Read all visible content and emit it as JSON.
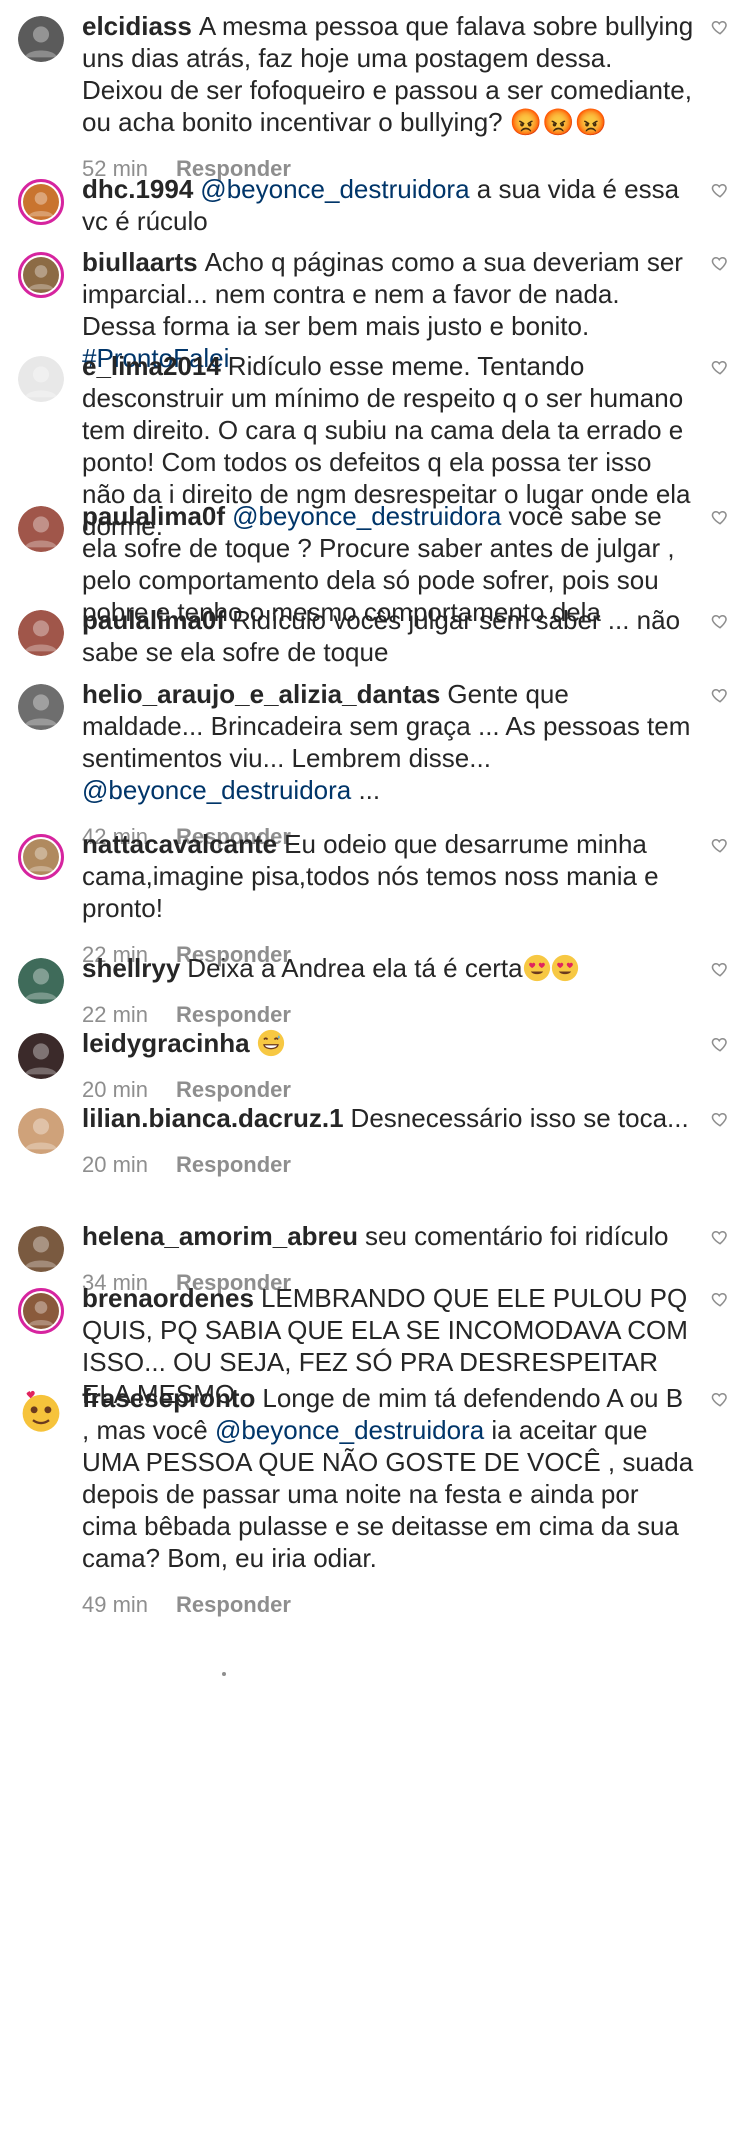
{
  "ui": {
    "reply_label": "Responder"
  },
  "comments": [
    {
      "user": "elcidiass",
      "avatar": {
        "icon": "user-avatar",
        "color": "#5b5b5b",
        "ring": false
      },
      "parts": [
        {
          "t": "A mesma pessoa que falava sobre bullying uns dias atrás, faz hoje uma postagem dessa. Deixou de ser fofoqueiro e passou a ser comediante, ou acha bonito incentivar o bullying? 😡😡😡"
        }
      ],
      "time": "52 min"
    },
    {
      "user": "dhc.1994",
      "avatar": {
        "icon": "user-avatar",
        "color": "#c9742f",
        "ring": true
      },
      "parts": [
        {
          "t": "@beyonce_destruidora",
          "type": "mention"
        },
        {
          "t": " a sua vida é essa vc é rúculo"
        }
      ]
    },
    {
      "user": "biullaarts",
      "avatar": {
        "icon": "user-avatar",
        "color": "#8c6b45",
        "ring": true
      },
      "parts": [
        {
          "t": "Acho q páginas como a sua deveriam ser imparcial... nem contra e nem a favor de nada. Dessa forma ia ser bem mais justo e bonito. "
        },
        {
          "t": "#ProntoFalei",
          "type": "hashtag"
        }
      ]
    },
    {
      "user": "e_lima2014",
      "avatar": {
        "icon": "user-avatar",
        "color": "#e8e8e8",
        "ring": false
      },
      "parts": [
        {
          "t": "Ridículo esse meme. Tentando desconstruir um mínimo de respeito q o ser humano tem direito. O cara q subiu na cama dela ta errado e ponto! Com todos os defeitos q ela possa ter isso não da i direito de ngm desrespeitar o lugar onde ela dorme."
        }
      ]
    },
    {
      "user": "paulalima0f",
      "avatar": {
        "icon": "user-avatar",
        "color": "#a0564a",
        "ring": false
      },
      "parts": [
        {
          "t": "@beyonce_destruidora",
          "type": "mention"
        },
        {
          "t": "  você sabe se ela sofre de toque ? Procure saber antes de julgar , pelo comportamento dela só pode  sofrer, pois sou pobre e tenho o mesmo comportamento dela"
        }
      ]
    },
    {
      "user": "paulalima0f",
      "avatar": {
        "icon": "user-avatar",
        "color": "#a0564a",
        "ring": false
      },
      "parts": [
        {
          "t": "Ridículo vocês julgar sem saber ... não sabe se ela sofre de toque"
        }
      ]
    },
    {
      "user": "helio_araujo_e_alizia_dantas",
      "avatar": {
        "icon": "user-avatar",
        "color": "#6e6e6e",
        "ring": false
      },
      "parts": [
        {
          "t": "Gente que maldade... Brincadeira sem graça ... As pessoas tem sentimentos viu... Lembrem disse... "
        },
        {
          "t": "@beyonce_destruidora",
          "type": "mention"
        },
        {
          "t": " ..."
        }
      ],
      "time": "42 min"
    },
    {
      "user": "nattacavalcante",
      "avatar": {
        "icon": "user-avatar",
        "color": "#b08a5f",
        "ring": true
      },
      "parts": [
        {
          "t": "Eu odeio que desarrume minha cama,imagine pisa,todos nós temos noss mania e pronto!"
        }
      ],
      "time": "22 min"
    },
    {
      "user": "shellryy",
      "avatar": {
        "icon": "user-avatar",
        "color": "#3f6b5a",
        "ring": false
      },
      "parts": [
        {
          "t": "Deixa a Andrea  ela tá é certa"
        },
        {
          "emoji": "heart-eyes"
        },
        {
          "emoji": "heart-eyes"
        }
      ],
      "time": "22 min"
    },
    {
      "user": "leidygracinha",
      "avatar": {
        "icon": "user-avatar",
        "color": "#3b2a2a",
        "ring": false
      },
      "parts": [
        {
          "emoji": "grin-sweat"
        }
      ],
      "time": "20 min"
    },
    {
      "user": "lilian.bianca.dacruz.1",
      "avatar": {
        "icon": "user-avatar",
        "color": "#cfa27a",
        "ring": false
      },
      "parts": [
        {
          "t": "Desnecessário isso se toca..."
        }
      ],
      "time": "20 min"
    },
    {
      "user": "helena_amorim_abreu",
      "avatar": {
        "icon": "user-avatar",
        "color": "#7a5a40",
        "ring": false
      },
      "parts": [
        {
          "t": "seu comentário foi ridículo"
        }
      ],
      "time": "34 min"
    },
    {
      "user": "brenaordenes",
      "avatar": {
        "icon": "user-avatar",
        "color": "#8a5a3c",
        "ring": true
      },
      "parts": [
        {
          "t": "LEMBRANDO QUE ELE PULOU PQ QUIS, PQ SABIA QUE ELA SE INCOMODAVA COM ISSO... OU SEJA, FEZ SÓ PRA DESRESPEITAR ELA MESMO"
        }
      ]
    },
    {
      "user": "frasesepronto",
      "avatar": {
        "icon": "emoji-avatar",
        "color": "#f6c33b",
        "ring": false
      },
      "parts": [
        {
          "t": "Longe de mim tá defendendo A ou B , mas você "
        },
        {
          "t": "@beyonce_destruidora",
          "type": "mention"
        },
        {
          "t": " ia aceitar  que UMA PESSOA QUE NÃO GOSTE DE VOCÊ , suada depois de passar uma noite na festa e ainda por cima bêbada pulasse e se deitasse  em cima da sua cama? Bom, eu iria odiar."
        }
      ],
      "time": "49 min"
    }
  ]
}
